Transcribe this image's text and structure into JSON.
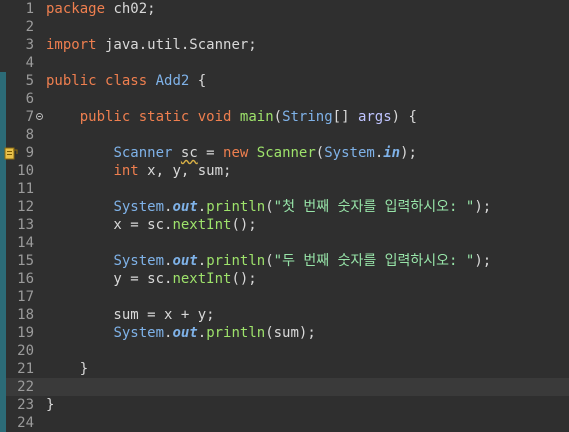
{
  "editor": {
    "lines": [
      {
        "n": "1",
        "parts": [
          [
            "kw",
            "package"
          ],
          [
            "plain",
            " ch02;"
          ]
        ]
      },
      {
        "n": "2",
        "parts": []
      },
      {
        "n": "3",
        "parts": [
          [
            "kw",
            "import"
          ],
          [
            "plain",
            " java.util.Scanner;"
          ]
        ]
      },
      {
        "n": "4",
        "parts": []
      },
      {
        "n": "5",
        "parts": [
          [
            "kw",
            "public"
          ],
          [
            "plain",
            " "
          ],
          [
            "kw",
            "class"
          ],
          [
            "plain",
            " "
          ],
          [
            "cls",
            "Add2"
          ],
          [
            "plain",
            " {"
          ]
        ]
      },
      {
        "n": "6",
        "parts": []
      },
      {
        "n": "7",
        "parts": [
          [
            "plain",
            "    "
          ],
          [
            "kw",
            "public"
          ],
          [
            "plain",
            " "
          ],
          [
            "kw",
            "static"
          ],
          [
            "plain",
            " "
          ],
          [
            "kw",
            "void"
          ],
          [
            "plain",
            " "
          ],
          [
            "fn",
            "main"
          ],
          [
            "plain",
            "("
          ],
          [
            "cls",
            "String"
          ],
          [
            "plain",
            "[] "
          ],
          [
            "param",
            "args"
          ],
          [
            "plain",
            ") {"
          ]
        ]
      },
      {
        "n": "8",
        "parts": []
      },
      {
        "n": "9",
        "parts": [
          [
            "plain",
            "        "
          ],
          [
            "cls",
            "Scanner"
          ],
          [
            "plain",
            " "
          ],
          [
            "var squiggle",
            "sc"
          ],
          [
            "plain",
            " = "
          ],
          [
            "kw",
            "new"
          ],
          [
            "plain",
            " "
          ],
          [
            "fn",
            "Scanner"
          ],
          [
            "plain",
            "("
          ],
          [
            "cls",
            "System"
          ],
          [
            "plain",
            "."
          ],
          [
            "field",
            "in"
          ],
          [
            "plain",
            ");"
          ]
        ]
      },
      {
        "n": "10",
        "parts": [
          [
            "plain",
            "        "
          ],
          [
            "kw",
            "int"
          ],
          [
            "plain",
            " x, y, sum;"
          ]
        ]
      },
      {
        "n": "11",
        "parts": []
      },
      {
        "n": "12",
        "parts": [
          [
            "plain",
            "        "
          ],
          [
            "cls",
            "System"
          ],
          [
            "plain",
            "."
          ],
          [
            "field",
            "out"
          ],
          [
            "plain",
            "."
          ],
          [
            "fn",
            "println"
          ],
          [
            "plain",
            "("
          ],
          [
            "str",
            "\"첫 번째 숫자를 입력하시오: \""
          ],
          [
            "plain",
            ");"
          ]
        ]
      },
      {
        "n": "13",
        "parts": [
          [
            "plain",
            "        x = sc."
          ],
          [
            "fn",
            "nextInt"
          ],
          [
            "plain",
            "();"
          ]
        ]
      },
      {
        "n": "14",
        "parts": []
      },
      {
        "n": "15",
        "parts": [
          [
            "plain",
            "        "
          ],
          [
            "cls",
            "System"
          ],
          [
            "plain",
            "."
          ],
          [
            "field",
            "out"
          ],
          [
            "plain",
            "."
          ],
          [
            "fn",
            "println"
          ],
          [
            "plain",
            "("
          ],
          [
            "str",
            "\"두 번째 숫자를 입력하시오: \""
          ],
          [
            "plain",
            ");"
          ]
        ]
      },
      {
        "n": "16",
        "parts": [
          [
            "plain",
            "        y = sc."
          ],
          [
            "fn",
            "nextInt"
          ],
          [
            "plain",
            "();"
          ]
        ]
      },
      {
        "n": "17",
        "parts": []
      },
      {
        "n": "18",
        "parts": [
          [
            "plain",
            "        sum = x + y;"
          ]
        ]
      },
      {
        "n": "19",
        "parts": [
          [
            "plain",
            "        "
          ],
          [
            "cls",
            "System"
          ],
          [
            "plain",
            "."
          ],
          [
            "field",
            "out"
          ],
          [
            "plain",
            "."
          ],
          [
            "fn",
            "println"
          ],
          [
            "plain",
            "(sum);"
          ]
        ]
      },
      {
        "n": "20",
        "parts": []
      },
      {
        "n": "21",
        "parts": [
          [
            "plain",
            "    }"
          ]
        ]
      },
      {
        "n": "22",
        "parts": []
      },
      {
        "n": "23",
        "parts": [
          [
            "plain",
            "}"
          ]
        ]
      },
      {
        "n": "24",
        "parts": []
      }
    ],
    "current_line": "22",
    "fold_line": "7",
    "warning_line": "9",
    "block_marker_lines": [
      "5",
      "6",
      "7",
      "8",
      "9",
      "10",
      "11",
      "12",
      "13",
      "14",
      "15",
      "16",
      "17",
      "18",
      "19",
      "20",
      "21",
      "22",
      "23",
      "24"
    ],
    "colors": {
      "background": "#2f2f2f",
      "keyword": "#ef7f4f",
      "type": "#7fb2e8",
      "method": "#9ee36b",
      "string": "#97e4a8",
      "marker": "#2c6b77"
    }
  }
}
